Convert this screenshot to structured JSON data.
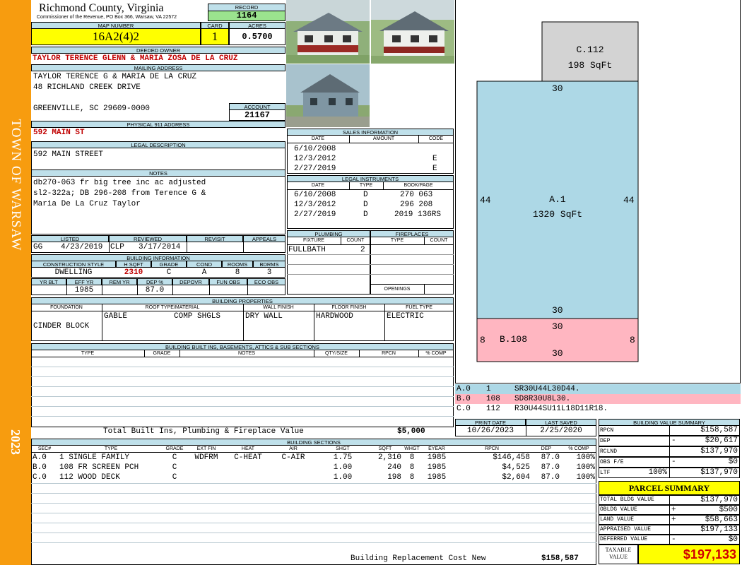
{
  "side": {
    "town": "TOWN OF WARSAW",
    "year": "2023"
  },
  "header": {
    "county": "Richmond County, Virginia",
    "commissioner": "Commissioner of the Revenue, PO Box 366, Warsaw, VA 22572",
    "record_label": "RECORD",
    "record": "1164",
    "map_label": "MAP NUMBER",
    "map_number": "16A2(4)2",
    "card_label": "CARD",
    "card": "1",
    "acres_label": "ACRES",
    "acres": "0.5700"
  },
  "owner": {
    "label": "DEEDED OWNER",
    "name": "TAYLOR TERENCE GLENN & MARIA ZOSA DE LA CRUZ",
    "mailing_label": "MAILING ADDRESS",
    "mail_line1": "TAYLOR TERENCE G & MARIA DE LA CRUZ",
    "mail_line2": "48 RICHLAND CREEK DRIVE",
    "mail_line3": "GREENVILLE, SC 29609-0000",
    "account_label": "ACCOUNT",
    "account": "21167"
  },
  "physical": {
    "label": "PHYSICAL 911 ADDRESS",
    "value": "592 MAIN ST"
  },
  "legal": {
    "label": "LEGAL DESCRIPTION",
    "value": "592 MAIN STREET"
  },
  "notes": {
    "label": "NOTES",
    "line1": "db270-063 fr big tree inc ac adjusted",
    "line2": "sl2-322a; DB 296-208 from Terence G &",
    "line3": "Maria De La Cruz Taylor"
  },
  "sales": {
    "label": "SALES INFORMATION",
    "cols": [
      "DATE",
      "AMOUNT",
      "CODE"
    ],
    "rows": [
      {
        "date": "6/10/2008",
        "amount": "",
        "code": ""
      },
      {
        "date": "12/3/2012",
        "amount": "",
        "code": "E"
      },
      {
        "date": "2/27/2019",
        "amount": "",
        "code": "E"
      }
    ]
  },
  "instruments": {
    "label": "LEGAL INSTRUMENTS",
    "cols": [
      "DATE",
      "TYPE",
      "BOOK/PAGE"
    ],
    "rows": [
      {
        "date": "6/10/2008",
        "type": "D",
        "book": "270 063"
      },
      {
        "date": "12/3/2012",
        "type": "D",
        "book": "296 208"
      },
      {
        "date": "2/27/2019",
        "type": "D",
        "book": "2019 136RS"
      }
    ]
  },
  "status": {
    "listed_label": "LISTED",
    "listed_by": "GG",
    "listed_date": "4/23/2019",
    "reviewed_label": "REVIEWED",
    "reviewed_by": "CLP",
    "reviewed_date": "3/17/2014",
    "revisit_label": "REVISIT",
    "appeals_label": "APPEALS"
  },
  "building_info": {
    "label": "BUILDING INFORMATION",
    "style_label": "CONSTRUCTION STYLE",
    "style": "DWELLING",
    "hsqft_label": "H SQFT",
    "hsqft": "2310",
    "grade_label": "GRADE",
    "grade": "C",
    "cond_label": "COND",
    "cond": "A",
    "rooms_label": "ROOMS",
    "rooms": "8",
    "bdrms_label": "BDRMS",
    "bdrms": "3",
    "yrblt_label": "YR BLT",
    "yrblt": "",
    "effyr_label": "EFF YR",
    "effyr": "1985",
    "remyr_label": "REM YR",
    "remyr": "",
    "dep_label": "DEP %",
    "dep": "87.0",
    "depovr_label": "DEPOVR",
    "depovr": "",
    "funobs_label": "FUN OBS",
    "funobs": "",
    "ecoobs_label": "ECO OBS",
    "ecoobs": ""
  },
  "plumbing": {
    "label": "PLUMBING",
    "fixture_label": "FIXTURE",
    "count_label": "COUNT",
    "rows": [
      {
        "fixture": "FULLBATH",
        "count": "2"
      }
    ]
  },
  "fireplaces": {
    "label": "FIREPLACES",
    "type_label": "TYPE",
    "count_label": "COUNT",
    "openings_label": "OPENINGS"
  },
  "properties": {
    "label": "BUILDING PROPERTIES",
    "foundation_label": "FOUNDATION",
    "foundation": "CINDER BLOCK",
    "roof_label": "ROOF TYPE/MATERIAL",
    "roof_type": "GABLE",
    "roof_material": "COMP SHGLS",
    "wall_label": "WALL FINISH",
    "wall": "DRY WALL",
    "floor_label": "FLOOR FINISH",
    "floor": "HARDWOOD",
    "fuel_label": "FUEL TYPE",
    "fuel": "ELECTRIC"
  },
  "builtins": {
    "label": "BUILDING BUILT INS, BASEMENTS, ATTICS & SUB SECTIONS",
    "cols": [
      "TYPE",
      "GRADE",
      "NOTES",
      "QTY/SIZE",
      "RPCN",
      "% COMP"
    ],
    "total_label": "Total Built Ins, Plumbing & Fireplace Value",
    "total": "$5,000"
  },
  "dates": {
    "print_label": "PRINT DATE",
    "print": "10/26/2023",
    "saved_label": "LAST SAVED",
    "saved": "2/25/2020"
  },
  "sections": {
    "label": "BUILDING SECTIONS",
    "cols": [
      "SEC#",
      "TYPE",
      "GRADE",
      "EXT FIN",
      "HEAT",
      "AIR",
      "SHGT",
      "SQFT",
      "WHGT",
      "EYEAR",
      "RPCN",
      "DEP",
      "% COMP"
    ],
    "rows": [
      {
        "sec": "A.0",
        "type": "1 SINGLE FAMILY",
        "grade": "C",
        "ext": "WDFRM",
        "heat": "C-HEAT",
        "air": "C-AIR",
        "shgt": "1.75",
        "sqft": "2,310",
        "whgt": "8",
        "eyear": "1985",
        "rpcn": "$146,458",
        "dep": "87.0",
        "comp": "100%"
      },
      {
        "sec": "B.0",
        "type": "108 FR SCREEN PCH",
        "grade": "C",
        "ext": "",
        "heat": "",
        "air": "",
        "shgt": "1.00",
        "sqft": "240",
        "whgt": "8",
        "eyear": "1985",
        "rpcn": "$4,525",
        "dep": "87.0",
        "comp": "100%"
      },
      {
        "sec": "C.0",
        "type": "112 WOOD DECK",
        "grade": "C",
        "ext": "",
        "heat": "",
        "air": "",
        "shgt": "1.00",
        "sqft": "198",
        "whgt": "8",
        "eyear": "1985",
        "rpcn": "$2,604",
        "dep": "87.0",
        "comp": "100%"
      }
    ],
    "replacement_label": "Building Replacement Cost New",
    "replacement": "$158,587"
  },
  "sketch": {
    "c_label": "C.112",
    "c_area": "198 SqFt",
    "a_label": "A.1",
    "a_area": "1320 SqFt",
    "b_label": "B.108",
    "a_top": "30",
    "a_left": "44",
    "a_right": "44",
    "a_bottom": "30",
    "b_top": "30",
    "b_left": "8",
    "b_right": "8",
    "b_bottom": "30",
    "colors": {
      "a": "#add8e6",
      "b": "#ffb6c1",
      "c": "#d3d3d3"
    }
  },
  "legend": [
    {
      "sec": "A.0",
      "code": "1",
      "path": "SR30U44L30D44."
    },
    {
      "sec": "B.0",
      "code": "108",
      "path": "SD8R30U8L30."
    },
    {
      "sec": "C.0",
      "code": "112",
      "path": "R30U44SU11L18D11R18."
    }
  ],
  "value_summary": {
    "label": "BUILDING VALUE SUMMARY",
    "rows": [
      {
        "k": "RPCN",
        "pct": "",
        "sign": "",
        "v": "$158,587"
      },
      {
        "k": "DEP",
        "pct": "",
        "sign": "-",
        "v": "$20,617"
      },
      {
        "k": "RCLND",
        "pct": "",
        "sign": "",
        "v": "$137,970"
      },
      {
        "k": "OBS F/E",
        "pct": "",
        "sign": "-",
        "v": "$0"
      },
      {
        "k": "LTF",
        "pct": "100%",
        "sign": "",
        "v": "$137,970"
      }
    ]
  },
  "parcel": {
    "label": "PARCEL SUMMARY",
    "rows": [
      {
        "k": "TOTAL BLDG VALUE",
        "sign": "",
        "v": "$137,970"
      },
      {
        "k": "OBLDG VALUE",
        "sign": "+",
        "v": "$500"
      },
      {
        "k": "LAND VALUE",
        "sign": "+",
        "v": "$58,663"
      },
      {
        "k": "APPRAISED VALUE",
        "sign": "",
        "v": "$197,133"
      },
      {
        "k": "DEFERRED VALUE",
        "sign": "-",
        "v": "$0"
      }
    ],
    "taxable_label1": "TAXABLE",
    "taxable_label2": "VALUE",
    "taxable": "$197,133"
  }
}
